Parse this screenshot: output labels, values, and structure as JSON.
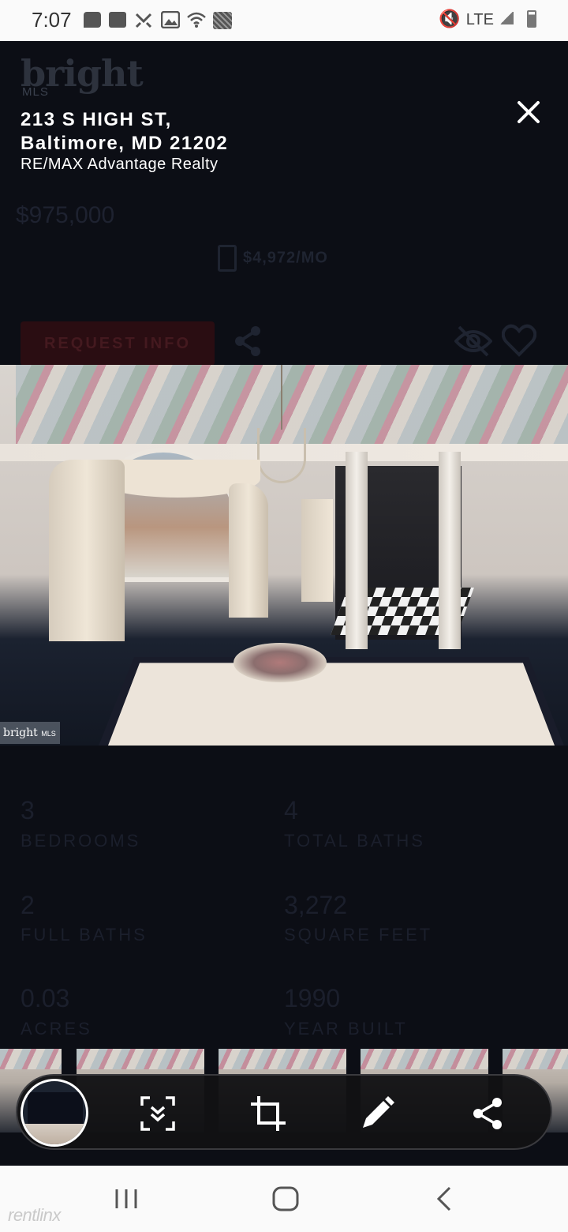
{
  "status_bar": {
    "time": "7:07",
    "network": "LTE",
    "icons": [
      "message-icon",
      "app-icon",
      "missed-call-icon",
      "image-icon",
      "wifi-icon",
      "screenshot-icon",
      "mute-icon",
      "signal-icon",
      "battery-icon"
    ]
  },
  "background_page": {
    "brand": "bright",
    "brand_sub": "MLS",
    "price": "$975,000",
    "monthly": "$4,972/MO",
    "request_button": "REQUEST INFO",
    "stats": [
      {
        "value": "3",
        "label": "BEDROOMS"
      },
      {
        "value": "4",
        "label": "TOTAL BATHS"
      },
      {
        "value": "2",
        "label": "FULL BATHS"
      },
      {
        "value": "3,272",
        "label": "SQUARE FEET"
      },
      {
        "value": "0.03",
        "label": "ACRES"
      },
      {
        "value": "1990",
        "label": "YEAR BUILT"
      }
    ]
  },
  "overlay": {
    "address_line1": "213 S HIGH ST,",
    "address_line2": "Baltimore, MD 21202",
    "broker": "RE/MAX Advantage Realty",
    "photo_badge": "bright",
    "photo_badge_sub": "MLS",
    "close_icon": "close-icon"
  },
  "screenshot_toolbar": {
    "buttons": [
      "scroll-capture-icon",
      "crop-icon",
      "edit-icon",
      "share-icon"
    ]
  },
  "nav_bar": {
    "buttons": [
      "recents-icon",
      "home-icon",
      "back-icon"
    ]
  },
  "watermark": "rentlinx"
}
